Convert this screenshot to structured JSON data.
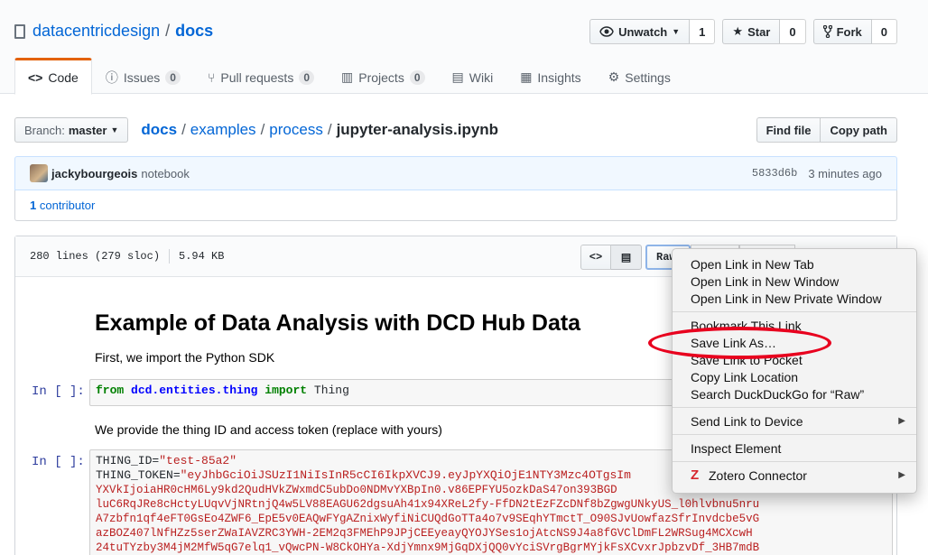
{
  "repo": {
    "owner": "datacentricdesign",
    "separator": "/",
    "name": "docs"
  },
  "actions": {
    "watch": {
      "label": "Unwatch",
      "count": "1"
    },
    "star": {
      "label": "Star",
      "count": "0"
    },
    "fork": {
      "label": "Fork",
      "count": "0"
    }
  },
  "tabs": [
    {
      "label": "Code"
    },
    {
      "label": "Issues",
      "count": "0"
    },
    {
      "label": "Pull requests",
      "count": "0"
    },
    {
      "label": "Projects",
      "count": "0"
    },
    {
      "label": "Wiki"
    },
    {
      "label": "Insights"
    },
    {
      "label": "Settings"
    }
  ],
  "file_nav": {
    "branch_label": "Branch:",
    "branch": "master",
    "crumbs": [
      "docs",
      "examples",
      "process"
    ],
    "sep": "/",
    "file": "jupyter-analysis.ipynb",
    "find_file": "Find file",
    "copy_path": "Copy path"
  },
  "commit": {
    "author": "jackybourgeois",
    "message": "notebook",
    "sha": "5833d6b",
    "time": "3 minutes ago",
    "contributors": "1",
    "contributors_label": "contributor"
  },
  "file": {
    "lines": "280 lines (279 sloc)",
    "size": "5.94 KB",
    "raw_label": "Raw"
  },
  "notebook": {
    "title": "Example of Data Analysis with DCD Hub Data",
    "intro": "First, we import the Python SDK",
    "prompt": "In [ ]:",
    "cell1": {
      "kw_from": "from",
      "module": "dcd.entities.thing",
      "kw_import": "import",
      "name": "Thing"
    },
    "text2": "We provide the thing ID and access token (replace with yours)",
    "cell2": {
      "line1_var": "THING_ID=",
      "line1_val": "\"test-85a2\"",
      "line2_var": "THING_TOKEN=",
      "line2_val": "\"eyJhbGciOiJSUzI1NiIsInR5cCI6IkpXVCJ9.eyJpYXQiOjE1NTY3Mzc4OTgsIm",
      "token_lines": [
        "YXVkIjoiaHR0cHM6Ly9kd2QudHVkZWxmdC5ubDo0NDMvYXBpIn0.v86EPFYU5ozkDaS47on393BGD",
        "luC6RqJRe8cHctyLUqvVjNRtnjQ4w5LV88EAGU62dgsuAh41x94XReL2fy-FfDN2tEzFZcDNf8bZgwgUNkyUS_l0hlvbnu5nru",
        "A7zbfn1qf4eFT0GsEo4ZWF6_EpE5v0EAQwFYgAZnixWyfiNiCUQdGoTTa4o7v9SEqhYTmctT_O90SJvUowfazSfrInvdcbe5vG",
        "azBOZ407lNfHZz5serZWaIAVZRC3YWH-2EM2q3FMEhP9JPjCEEyeayQYOJYSes1ojAtcNS9J4a8fGVClDmFL2WRSug4MCXcwH",
        "24tuTYzby3M4jM2MfW5qG7elq1_vQwcPN-W8CkOHYa-XdjYmnx9MjGqDXjQQ0vYciSVrgBgrMYjkFsXCvxrJpbzvDf_3HB7mdB"
      ]
    }
  },
  "context_menu": {
    "items": [
      "Open Link in New Tab",
      "Open Link in New Window",
      "Open Link in New Private Window",
      "Bookmark This Link",
      "Save Link As…",
      "Save Link to Pocket",
      "Copy Link Location",
      "Search DuckDuckGo for “Raw”",
      "Send Link to Device",
      "Inspect Element",
      "Zotero Connector"
    ]
  },
  "colors": {
    "link": "#0366d6",
    "accent_tab": "#e36209",
    "highlight_ellipse": "#e8001e"
  },
  "icons": [
    "repo-book-icon",
    "eye-icon",
    "star-icon",
    "fork-icon",
    "code-icon",
    "issue-icon",
    "pull-request-icon",
    "project-icon",
    "wiki-icon",
    "graph-icon",
    "gear-icon",
    "zotero-icon"
  ]
}
